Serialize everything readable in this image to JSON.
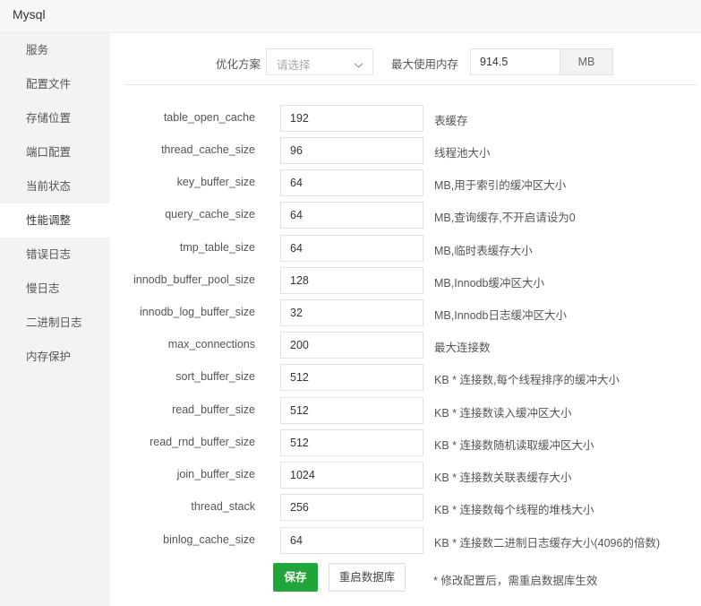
{
  "window": {
    "title": "Mysql"
  },
  "sidebar": {
    "items": [
      {
        "label": "服务"
      },
      {
        "label": "配置文件"
      },
      {
        "label": "存储位置"
      },
      {
        "label": "端口配置"
      },
      {
        "label": "当前状态"
      },
      {
        "label": "性能调整",
        "active": true
      },
      {
        "label": "错误日志"
      },
      {
        "label": "慢日志"
      },
      {
        "label": "二进制日志"
      },
      {
        "label": "内存保护"
      }
    ]
  },
  "topbar": {
    "scheme_label": "优化方案",
    "scheme_placeholder": "请选择",
    "memory_label": "最大使用内存",
    "memory_value": "914.5",
    "memory_unit": "MB"
  },
  "params": [
    {
      "name": "table_open_cache",
      "value": "192",
      "desc": "表缓存"
    },
    {
      "name": "thread_cache_size",
      "value": "96",
      "desc": "线程池大小"
    },
    {
      "name": "key_buffer_size",
      "value": "64",
      "desc": "MB,用于索引的缓冲区大小"
    },
    {
      "name": "query_cache_size",
      "value": "64",
      "desc": "MB,查询缓存,不开启请设为0"
    },
    {
      "name": "tmp_table_size",
      "value": "64",
      "desc": "MB,临时表缓存大小"
    },
    {
      "name": "innodb_buffer_pool_size",
      "value": "128",
      "desc": "MB,Innodb缓冲区大小"
    },
    {
      "name": "innodb_log_buffer_size",
      "value": "32",
      "desc": "MB,Innodb日志缓冲区大小"
    },
    {
      "name": "max_connections",
      "value": "200",
      "desc": "最大连接数"
    },
    {
      "name": "sort_buffer_size",
      "value": "512",
      "desc": "KB * 连接数,每个线程排序的缓冲大小"
    },
    {
      "name": "read_buffer_size",
      "value": "512",
      "desc": "KB * 连接数读入缓冲区大小"
    },
    {
      "name": "read_rnd_buffer_size",
      "value": "512",
      "desc": "KB * 连接数随机读取缓冲区大小"
    },
    {
      "name": "join_buffer_size",
      "value": "1024",
      "desc": "KB * 连接数关联表缓存大小"
    },
    {
      "name": "thread_stack",
      "value": "256",
      "desc": "KB * 连接数每个线程的堆栈大小"
    },
    {
      "name": "binlog_cache_size",
      "value": "64",
      "desc": "KB * 连接数二进制日志缓存大小(4096的倍数)"
    }
  ],
  "actions": {
    "save_label": "保存",
    "restart_label": "重启数据库",
    "note": "* 修改配置后，需重启数据库生效"
  },
  "colors": {
    "accent": "#20a53a",
    "sidebar_bg": "#f3f3f3"
  }
}
